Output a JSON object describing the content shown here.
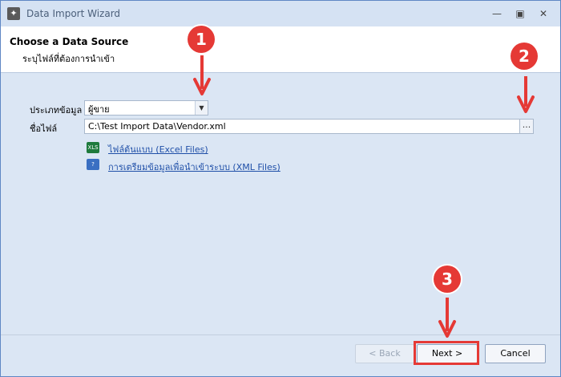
{
  "window": {
    "title": "Data Import Wizard"
  },
  "header": {
    "title": "Choose a Data Source",
    "subtitle": "ระบุไฟล์ที่ต้องการนำเข้า"
  },
  "form": {
    "data_type_label": "ประเภทข้อมูล",
    "data_type_value": "ผู้ขาย",
    "file_label": "ชื่อไฟล์",
    "file_value": "C:\\Test Import Data\\Vendor.xml",
    "browse_label": "..."
  },
  "links": [
    {
      "label": "ไฟล์ต้นแบบ (Excel Files)",
      "icon": "excel-file-icon",
      "color": "#1e7a3d"
    },
    {
      "label": "การเตรียมข้อมูลเพื่อนำเข้าระบบ (XML Files)",
      "icon": "help-document-icon",
      "color": "#3a6fc2"
    }
  ],
  "buttons": {
    "back": "< Back",
    "next": "Next >",
    "cancel": "Cancel"
  },
  "annotations": {
    "badge1": "1",
    "badge2": "2",
    "badge3": "3",
    "color": "#e53935"
  }
}
